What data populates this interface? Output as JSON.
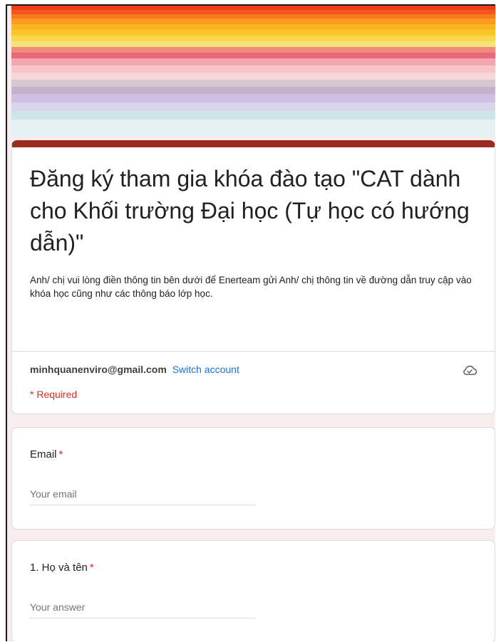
{
  "form": {
    "title": "Đăng ký tham gia khóa đào tạo \"CAT dành cho Khối trường Đại học (Tự học có hướng dẫn)\"",
    "description": "Anh/ chị vui lòng điền thông tin bên dưới để Enerteam gửi Anh/ chị thông tin về đường dẫn truy cập vào khóa học cũng như các thông báo lớp học.",
    "account_email": "minhquanenviro@gmail.com",
    "switch_account_label": "Switch account",
    "required_note": "* Required",
    "save_status_icon": "cloud-check-icon"
  },
  "questions": [
    {
      "label": "Email",
      "required_mark": "*",
      "value": "",
      "placeholder": "Your email"
    },
    {
      "label": "1. Họ và tên",
      "required_mark": "*",
      "value": "",
      "placeholder": "Your answer"
    }
  ],
  "colors": {
    "accent": "#9b2a1f",
    "required": "#d93025",
    "link": "#1a73e8",
    "page_background": "#f7eded"
  }
}
